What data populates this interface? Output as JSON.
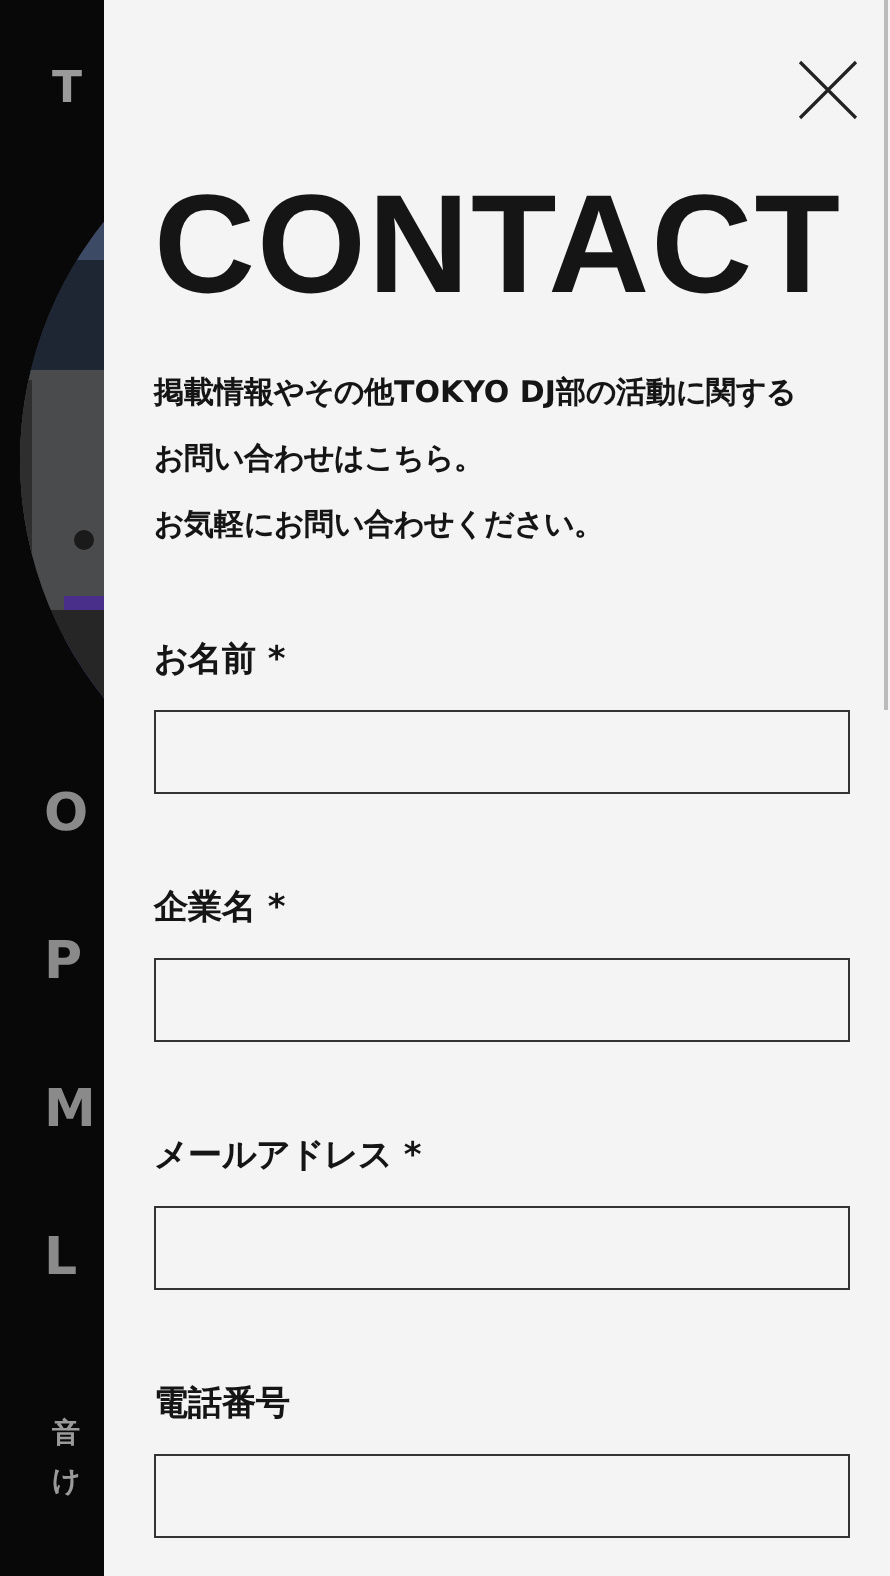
{
  "background_page": {
    "logo": "T",
    "menu": [
      {
        "label": "O"
      },
      {
        "label": "P"
      },
      {
        "label": "M"
      },
      {
        "label": "L"
      }
    ],
    "text_lines": [
      "音",
      "け"
    ]
  },
  "contact_panel": {
    "title": "CONTACT",
    "paragraphs": [
      "掲載情報やその他TOKYO DJ部の活動に関するお問い合わせはこちら。",
      "お気軽にお問い合わせください。"
    ],
    "fields": [
      {
        "label": "お名前 *"
      },
      {
        "label": "企業名 *"
      },
      {
        "label": "メールアドレス *"
      },
      {
        "label": "電話番号"
      }
    ]
  }
}
